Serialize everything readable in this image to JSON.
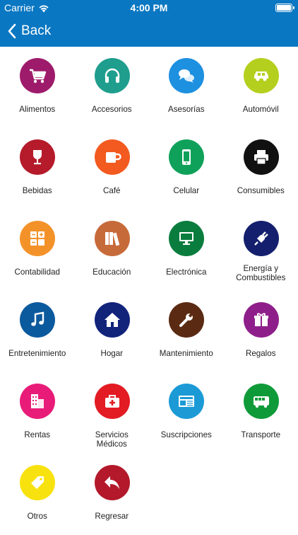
{
  "status_bar": {
    "carrier": "Carrier",
    "time": "4:00 PM"
  },
  "nav": {
    "back_label": "Back"
  },
  "categories": [
    {
      "label": "Alimentos",
      "color": "#9e1b6b",
      "icon": "shopping-cart-icon"
    },
    {
      "label": "Accesorios",
      "color": "#1f9e8e",
      "icon": "headphones-icon"
    },
    {
      "label": "Asesorías",
      "color": "#1e90e0",
      "icon": "chat-bubbles-icon"
    },
    {
      "label": "Automóvil",
      "color": "#b5cf1e",
      "icon": "car-icon"
    },
    {
      "label": "Bebidas",
      "color": "#b51b2a",
      "icon": "wine-glass-icon"
    },
    {
      "label": "Café",
      "color": "#f25a1f",
      "icon": "coffee-cup-icon"
    },
    {
      "label": "Celular",
      "color": "#0fa15a",
      "icon": "mobile-phone-icon"
    },
    {
      "label": "Consumibles",
      "color": "#111111",
      "icon": "printer-icon"
    },
    {
      "label": "Contabilidad",
      "color": "#f4922a",
      "icon": "calculator-icon"
    },
    {
      "label": "Educación",
      "color": "#c76a3a",
      "icon": "books-icon"
    },
    {
      "label": "Electrónica",
      "color": "#0a7d3e",
      "icon": "monitor-icon"
    },
    {
      "label": "Energía y Combustibles",
      "color": "#14206e",
      "icon": "power-plug-icon"
    },
    {
      "label": "Entretenimiento",
      "color": "#0c5a9e",
      "icon": "music-note-icon"
    },
    {
      "label": "Hogar",
      "color": "#12237a",
      "icon": "house-icon"
    },
    {
      "label": "Mantenimiento",
      "color": "#5a2a12",
      "icon": "wrench-icon"
    },
    {
      "label": "Regalos",
      "color": "#8e1f8a",
      "icon": "gift-icon"
    },
    {
      "label": "Rentas",
      "color": "#e81c78",
      "icon": "building-icon"
    },
    {
      "label": "Servicios Médicos",
      "color": "#e31b23",
      "icon": "first-aid-kit-icon"
    },
    {
      "label": "Suscripciones",
      "color": "#1b9ad6",
      "icon": "newspaper-icon"
    },
    {
      "label": "Transporte",
      "color": "#0f9a3a",
      "icon": "bus-icon"
    },
    {
      "label": "Otros",
      "color": "#f7e20f",
      "icon": "tag-icon"
    },
    {
      "label": "Regresar",
      "color": "#b3192a",
      "icon": "return-arrow-icon"
    }
  ]
}
